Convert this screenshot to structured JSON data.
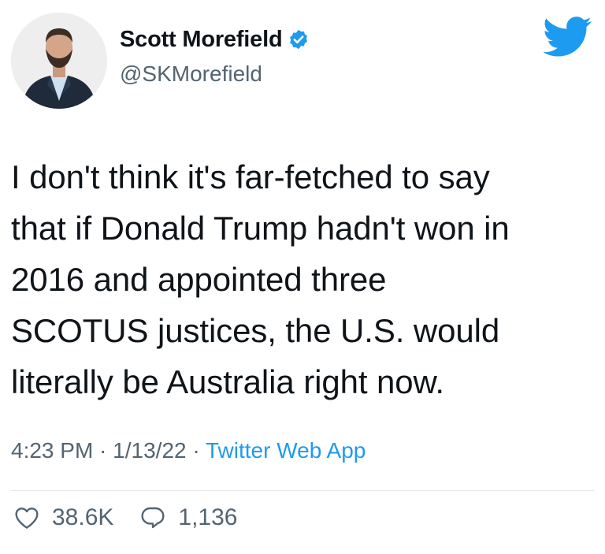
{
  "author": {
    "display_name": "Scott Morefield",
    "handle": "@SKMorefield",
    "verified": true,
    "avatar_icon": "profile-photo"
  },
  "brand": {
    "icon": "twitter-bird-icon",
    "color": "#1d9bf0"
  },
  "tweet": {
    "lines": [
      "I don't think it's far-fetched to say",
      "that if Donald Trump hadn't won in",
      "2016 and appointed three",
      "SCOTUS justices, the U.S. would",
      "literally be Australia right now."
    ]
  },
  "meta": {
    "time": "4:23 PM",
    "separator": " · ",
    "date": "1/13/22",
    "source": "Twitter Web App"
  },
  "stats": {
    "likes": "38.6K",
    "replies": "1,136"
  },
  "colors": {
    "text": "#0f1419",
    "secondary": "#536471",
    "accent": "#1d9bf0"
  }
}
